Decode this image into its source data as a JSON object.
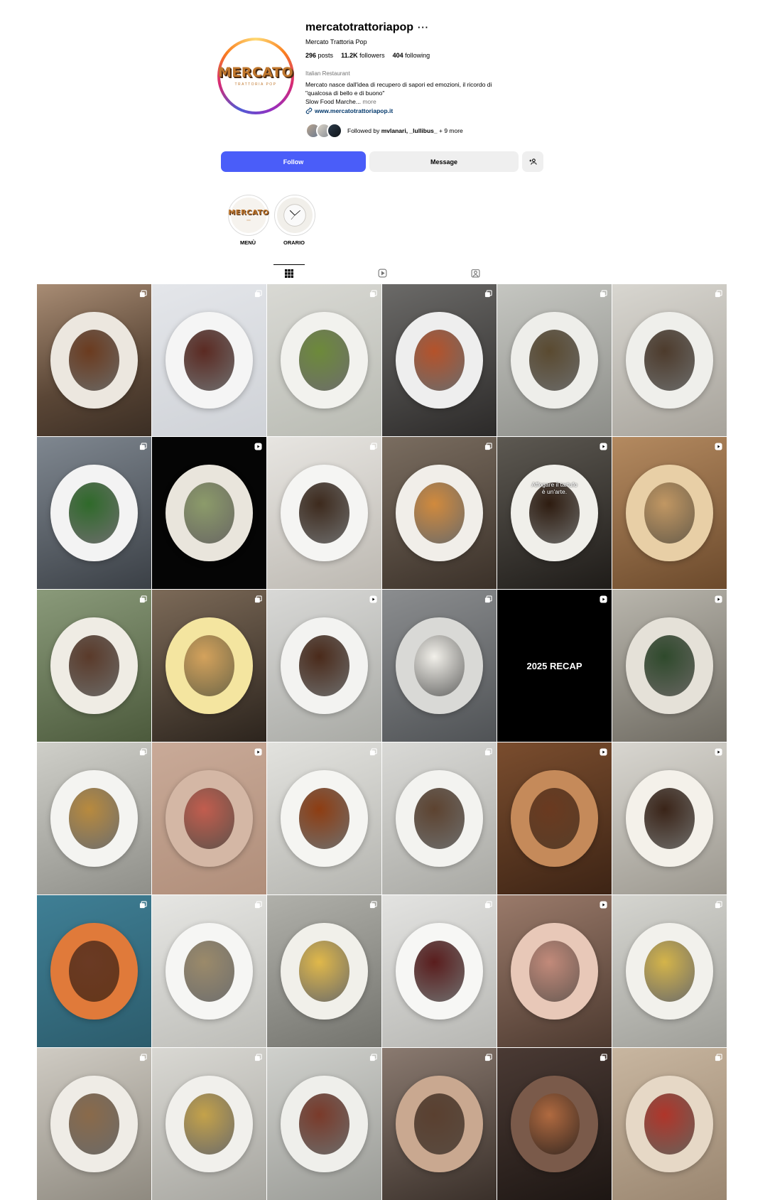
{
  "profile": {
    "username": "mercatotrattoriapop",
    "options": "···",
    "full_name": "Mercato Trattoria Pop",
    "avatar_logo": "MERCATO",
    "avatar_logo_sub": "TRATTORIA POP",
    "stats": {
      "posts_count": "296",
      "posts_label": "posts",
      "followers_count": "11.2K",
      "followers_label": "followers",
      "following_count": "404",
      "following_label": "following"
    },
    "category": "Italian Restaurant",
    "bio_line1": "Mercato nasce dall'idea di recupero di sapori ed emozioni, il ricordo di",
    "bio_line2": "\"qualcosa di bello e di buono\"",
    "bio_line3": "Slow Food Marche...",
    "bio_more": "more",
    "link": "www.mercatotrattoriapop.it",
    "followed_by_prefix": "Followed by",
    "followed_by_names": "mvlanari, _lullibus_",
    "followed_by_suffix": "+ 9 more"
  },
  "actions": {
    "follow": "Follow",
    "message": "Message"
  },
  "highlights": [
    {
      "label": "MENÙ",
      "logo": "MERCATO"
    },
    {
      "label": "ORARIO"
    }
  ],
  "tabs": [
    "posts-grid-icon",
    "reels-icon",
    "tagged-icon"
  ],
  "grid": {
    "overlay_texts": {
      "truffle_line1": "Affogare il tartufo",
      "truffle_line2": "è un'arte.",
      "recap": "2025 RECAP"
    },
    "tiles": [
      {
        "type": "carousel"
      },
      {
        "type": "carousel"
      },
      {
        "type": "carousel"
      },
      {
        "type": "carousel"
      },
      {
        "type": "carousel"
      },
      {
        "type": "carousel"
      },
      {
        "type": "carousel"
      },
      {
        "type": "reel"
      },
      {
        "type": "carousel"
      },
      {
        "type": "carousel"
      },
      {
        "type": "reel"
      },
      {
        "type": "reel"
      },
      {
        "type": "carousel"
      },
      {
        "type": "carousel"
      },
      {
        "type": "reel"
      },
      {
        "type": "carousel"
      },
      {
        "type": "reel"
      },
      {
        "type": "reel"
      },
      {
        "type": "carousel"
      },
      {
        "type": "reel"
      },
      {
        "type": "carousel"
      },
      {
        "type": "carousel"
      },
      {
        "type": "reel"
      },
      {
        "type": "reel"
      },
      {
        "type": "carousel"
      },
      {
        "type": "carousel"
      },
      {
        "type": "carousel"
      },
      {
        "type": "carousel"
      },
      {
        "type": "reel"
      },
      {
        "type": "carousel"
      },
      {
        "type": "carousel"
      },
      {
        "type": "carousel"
      },
      {
        "type": "carousel"
      },
      {
        "type": "carousel"
      },
      {
        "type": "carousel"
      },
      {
        "type": "carousel"
      }
    ]
  },
  "colors": {
    "follow_button": "#4a5df9",
    "secondary_button": "#efefef",
    "link": "#00376b",
    "muted_text": "#737373",
    "brand_logo": "#c0772d"
  }
}
